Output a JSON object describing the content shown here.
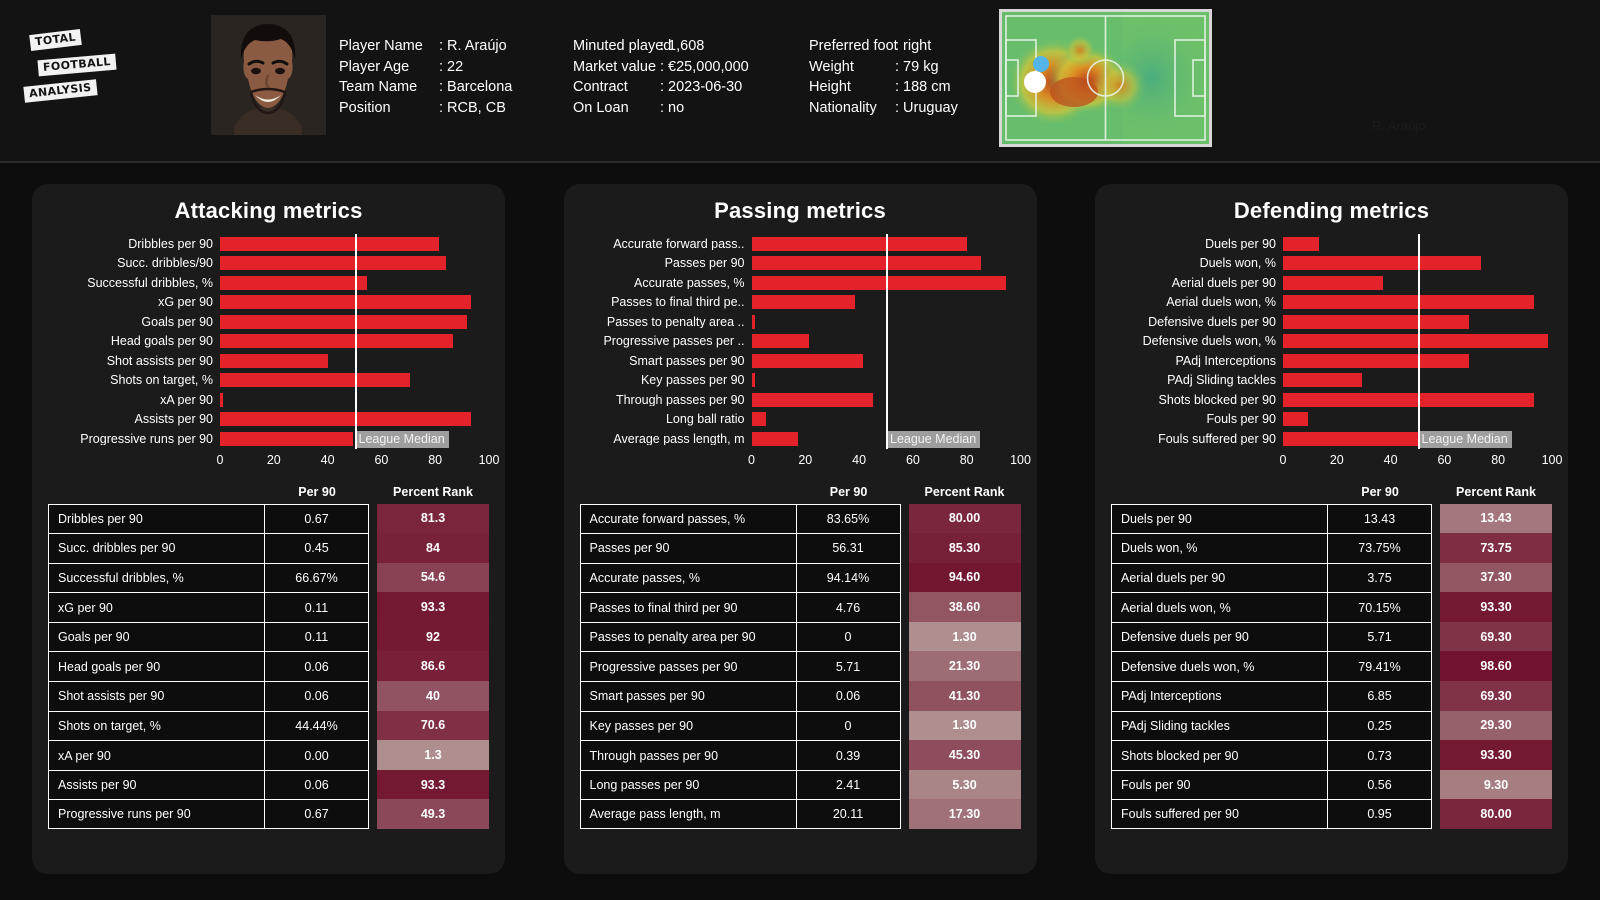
{
  "brand": {
    "line1": "TOTAL",
    "line2": "FOOTBALL",
    "line3": "ANALYSIS"
  },
  "watermark": "R. Araújo",
  "player_info": {
    "column_a": [
      {
        "key": "Player Name",
        "value": ": R. Araújo"
      },
      {
        "key": "Player Age",
        "value": ": 22"
      },
      {
        "key": "Team Name",
        "value": ": Barcelona"
      },
      {
        "key": "Position",
        "value": ": RCB, CB"
      }
    ],
    "column_b": [
      {
        "key": "Minuted played",
        "value": ": 1,608"
      },
      {
        "key": "Market value",
        "value": ": €25,000,000"
      },
      {
        "key": "Contract",
        "value": ": 2023-06-30"
      },
      {
        "key": "On Loan",
        "value": ": no"
      }
    ],
    "column_c": [
      {
        "key": "Preferred foot",
        "value": ": right"
      },
      {
        "key": "Weight",
        "value": ": 79 kg"
      },
      {
        "key": "Height",
        "value": ": 188 cm"
      },
      {
        "key": "Nationality",
        "value": ": Uruguay"
      }
    ]
  },
  "colors": {
    "bar": "#e4222a",
    "median_line": "#ffffff",
    "median_tag_bg": "#9e9e9e",
    "panel_bg": "#1b1b1b",
    "page_bg": "#0d0d0d"
  },
  "table_headers": {
    "metric": "",
    "per90": "Per 90",
    "percent_rank": "Percent Rank"
  },
  "median_label": "League Median",
  "chart_data": [
    {
      "type": "bar",
      "title": "Attacking metrics",
      "xlabel": "",
      "ylabel": "",
      "xlim": [
        0,
        100
      ],
      "ticks": [
        0,
        20,
        40,
        60,
        80,
        100
      ],
      "orientation": "horizontal",
      "median": 50,
      "median_label": "League Median",
      "categories": [
        "Dribbles per 90",
        "Succ. dribbles/90",
        "Successful dribbles, %",
        "xG per 90",
        "Goals per 90",
        "Head goals per 90",
        "Shot assists per 90",
        "Shots on target, %",
        "xA per 90",
        "Assists per 90",
        "Progressive runs per 90"
      ],
      "values": [
        81.3,
        84,
        54.6,
        93.3,
        92,
        86.6,
        40,
        70.6,
        1.3,
        93.3,
        49.3
      ]
    },
    {
      "type": "bar",
      "title": "Passing metrics",
      "xlabel": "",
      "ylabel": "",
      "xlim": [
        0,
        100
      ],
      "ticks": [
        0,
        20,
        40,
        60,
        80,
        100
      ],
      "orientation": "horizontal",
      "median": 50,
      "median_label": "League Median",
      "categories": [
        "Accurate forward pass..",
        "Passes per 90",
        "Accurate passes, %",
        "Passes to final third pe..",
        "Passes to penalty area ..",
        "Progressive passes per ..",
        "Smart passes per 90",
        "Key passes per 90",
        "Through passes per 90",
        "Long ball ratio",
        "Average pass length, m"
      ],
      "values": [
        80.0,
        85.3,
        94.6,
        38.6,
        1.3,
        21.3,
        41.3,
        1.3,
        45.3,
        5.3,
        17.3
      ]
    },
    {
      "type": "bar",
      "title": "Defending metrics",
      "xlabel": "",
      "ylabel": "",
      "xlim": [
        0,
        100
      ],
      "ticks": [
        0,
        20,
        40,
        60,
        80,
        100
      ],
      "orientation": "horizontal",
      "median": 50,
      "median_label": "League Median",
      "categories": [
        "Duels per 90",
        "Duels won, %",
        "Aerial duels per 90",
        "Aerial duels won, %",
        "Defensive duels per 90",
        "Defensive duels won, %",
        "PAdj Interceptions",
        "PAdj Sliding tackles",
        "Shots blocked per 90",
        "Fouls per 90",
        "Fouls suffered per 90"
      ],
      "values": [
        13.43,
        73.75,
        37.3,
        93.3,
        69.3,
        98.6,
        69.3,
        29.3,
        93.3,
        9.3,
        80.0
      ]
    }
  ],
  "tables": [
    {
      "id": "attacking",
      "rows": [
        {
          "metric": "Dribbles per 90",
          "per90": "0.67",
          "rank": "81.3",
          "rank_value": 81.3
        },
        {
          "metric": "Succ. dribbles per 90",
          "per90": "0.45",
          "rank": "84",
          "rank_value": 84
        },
        {
          "metric": "Successful dribbles, %",
          "per90": "66.67%",
          "rank": "54.6",
          "rank_value": 54.6
        },
        {
          "metric": "xG per 90",
          "per90": "0.11",
          "rank": "93.3",
          "rank_value": 93.3
        },
        {
          "metric": "Goals per 90",
          "per90": "0.11",
          "rank": "92",
          "rank_value": 92
        },
        {
          "metric": "Head goals per 90",
          "per90": "0.06",
          "rank": "86.6",
          "rank_value": 86.6
        },
        {
          "metric": "Shot assists per 90",
          "per90": "0.06",
          "rank": "40",
          "rank_value": 40
        },
        {
          "metric": "Shots on target, %",
          "per90": "44.44%",
          "rank": "70.6",
          "rank_value": 70.6
        },
        {
          "metric": "xA per 90",
          "per90": "0.00",
          "rank": "1.3",
          "rank_value": 1.3
        },
        {
          "metric": "Assists per 90",
          "per90": "0.06",
          "rank": "93.3",
          "rank_value": 93.3
        },
        {
          "metric": "Progressive runs per 90",
          "per90": "0.67",
          "rank": "49.3",
          "rank_value": 49.3
        }
      ]
    },
    {
      "id": "passing",
      "rows": [
        {
          "metric": "Accurate forward passes, %",
          "per90": "83.65%",
          "rank": "80.00",
          "rank_value": 80.0
        },
        {
          "metric": "Passes per 90",
          "per90": "56.31",
          "rank": "85.30",
          "rank_value": 85.3
        },
        {
          "metric": "Accurate passes, %",
          "per90": "94.14%",
          "rank": "94.60",
          "rank_value": 94.6
        },
        {
          "metric": "Passes to final third per 90",
          "per90": "4.76",
          "rank": "38.60",
          "rank_value": 38.6
        },
        {
          "metric": "Passes to penalty area per 90",
          "per90": "0",
          "rank": "1.30",
          "rank_value": 1.3
        },
        {
          "metric": "Progressive passes per 90",
          "per90": "5.71",
          "rank": "21.30",
          "rank_value": 21.3
        },
        {
          "metric": "Smart passes per 90",
          "per90": "0.06",
          "rank": "41.30",
          "rank_value": 41.3
        },
        {
          "metric": "Key passes per 90",
          "per90": "0",
          "rank": "1.30",
          "rank_value": 1.3
        },
        {
          "metric": "Through passes per 90",
          "per90": "0.39",
          "rank": "45.30",
          "rank_value": 45.3
        },
        {
          "metric": "Long passes per 90",
          "per90": "2.41",
          "rank": "5.30",
          "rank_value": 5.3
        },
        {
          "metric": "Average pass length, m",
          "per90": "20.11",
          "rank": "17.30",
          "rank_value": 17.3
        }
      ]
    },
    {
      "id": "defending",
      "rows": [
        {
          "metric": "Duels per 90",
          "per90": "13.43",
          "rank": "13.43",
          "rank_value": 13.43
        },
        {
          "metric": "Duels won, %",
          "per90": "73.75%",
          "rank": "73.75",
          "rank_value": 73.75
        },
        {
          "metric": "Aerial duels per 90",
          "per90": "3.75",
          "rank": "37.30",
          "rank_value": 37.3
        },
        {
          "metric": "Aerial duels won, %",
          "per90": "70.15%",
          "rank": "93.30",
          "rank_value": 93.3
        },
        {
          "metric": "Defensive duels per 90",
          "per90": "5.71",
          "rank": "69.30",
          "rank_value": 69.3
        },
        {
          "metric": "Defensive duels won, %",
          "per90": "79.41%",
          "rank": "98.60",
          "rank_value": 98.6
        },
        {
          "metric": "PAdj Interceptions",
          "per90": "6.85",
          "rank": "69.30",
          "rank_value": 69.3
        },
        {
          "metric": "PAdj Sliding tackles",
          "per90": "0.25",
          "rank": "29.30",
          "rank_value": 29.3
        },
        {
          "metric": "Shots blocked per 90",
          "per90": "0.73",
          "rank": "93.30",
          "rank_value": 93.3
        },
        {
          "metric": "Fouls per 90",
          "per90": "0.56",
          "rank": "9.30",
          "rank_value": 9.3
        },
        {
          "metric": "Fouls suffered per 90",
          "per90": "0.95",
          "rank": "80.00",
          "rank_value": 80.0
        }
      ]
    }
  ]
}
